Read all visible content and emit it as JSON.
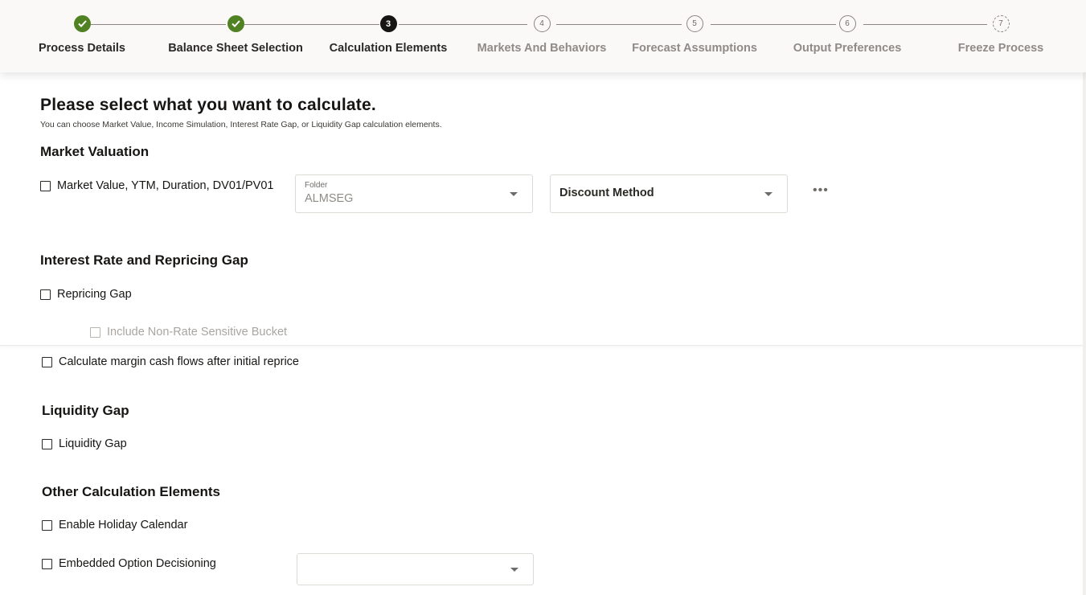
{
  "train": {
    "steps": [
      {
        "label": "Process Details",
        "marker": "",
        "state": "done"
      },
      {
        "label": "Balance Sheet Selection",
        "marker": "",
        "state": "done"
      },
      {
        "label": "Calculation Elements",
        "marker": "3",
        "state": "current"
      },
      {
        "label": "Markets And Behaviors",
        "marker": "4",
        "state": "future"
      },
      {
        "label": "Forecast Assumptions",
        "marker": "5",
        "state": "future"
      },
      {
        "label": "Output Preferences",
        "marker": "6",
        "state": "future"
      },
      {
        "label": "Freeze Process",
        "marker": "7",
        "state": "future"
      }
    ]
  },
  "page": {
    "title": "Please select what you want to calculate.",
    "subtitle": "You can choose Market Value, Income Simulation, Interest Rate Gap, or Liquidity Gap calculation elements."
  },
  "market_valuation": {
    "heading": "Market Valuation",
    "checkbox_label": "Market Value, YTM, Duration, DV01/PV01",
    "checked": false,
    "folder_label": "Folder",
    "folder_value": "ALMSEG",
    "discount_method_placeholder": "Discount Method",
    "more_label": "•••"
  },
  "interest_rate": {
    "heading": "Interest Rate and Repricing Gap",
    "repricing_gap_label": "Repricing Gap",
    "repricing_gap_checked": false,
    "non_rate_sensitive_label": "Include Non-Rate Sensitive Bucket",
    "non_rate_sensitive_disabled": true,
    "margin_cash_flows_label": "Calculate margin cash flows after initial reprice",
    "margin_cash_flows_checked": false
  },
  "liquidity": {
    "heading": "Liquidity Gap",
    "checkbox_label": "Liquidity Gap",
    "checked": false
  },
  "other": {
    "heading": "Other Calculation Elements",
    "holiday_calendar_label": "Enable Holiday Calendar",
    "holiday_calendar_checked": false,
    "embedded_option_label": "Embedded Option Decisioning",
    "embedded_option_checked": false,
    "embedded_option_value": ""
  },
  "colors": {
    "done": "#508223",
    "current": "#161513",
    "inactive_text": "#8f8b86"
  }
}
